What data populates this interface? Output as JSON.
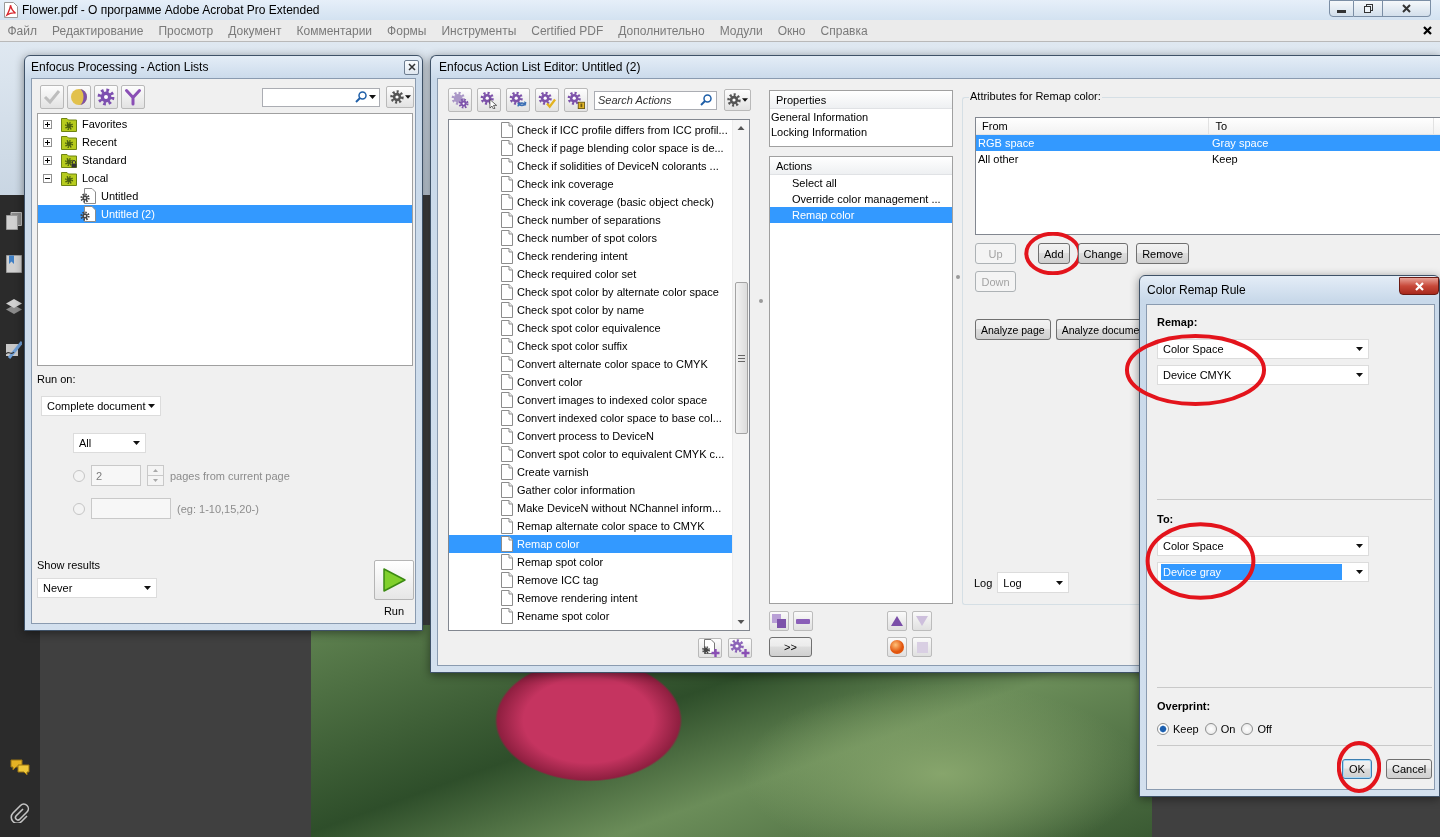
{
  "acrobat": {
    "title": "Flower.pdf - О программе Adobe Acrobat Pro Extended",
    "menu": [
      {
        "label": "Файл",
        "disabled": true
      },
      {
        "label": "Редактирование",
        "disabled": true
      },
      {
        "label": "Просмотр",
        "disabled": true
      },
      {
        "label": "Документ",
        "disabled": true
      },
      {
        "label": "Комментарии",
        "disabled": true
      },
      {
        "label": "Формы",
        "disabled": true
      },
      {
        "label": "Инструменты",
        "disabled": true
      },
      {
        "label": "Certified PDF",
        "disabled": true
      },
      {
        "label": "Дополнительно",
        "disabled": true
      },
      {
        "label": "Модули",
        "disabled": true
      },
      {
        "label": "Окно",
        "disabled": true
      },
      {
        "label": "Справка",
        "disabled": true
      }
    ]
  },
  "action_lists": {
    "title": "Enfocus Processing - Action Lists",
    "tree": [
      {
        "label": "Favorites",
        "expanded": false,
        "locked": false,
        "selected": false
      },
      {
        "label": "Recent",
        "expanded": false,
        "locked": false,
        "selected": false
      },
      {
        "label": "Standard",
        "expanded": false,
        "locked": true,
        "selected": false
      },
      {
        "label": "Local",
        "expanded": true,
        "locked": false,
        "selected": false,
        "children": [
          {
            "label": "Untitled",
            "selected": false
          },
          {
            "label": "Untitled (2)",
            "selected": true
          }
        ]
      }
    ],
    "run_on": {
      "label": "Run on:",
      "scope": "Complete document",
      "pages": "All",
      "options": [
        {
          "kind": "count",
          "value": "2",
          "label": "pages from current page",
          "selected": false,
          "disabled": true
        },
        {
          "kind": "range",
          "label": "(eg: 1-10,15,20-)",
          "selected": false,
          "disabled": true
        }
      ]
    },
    "show_results": {
      "label": "Show results",
      "value": "Never"
    },
    "run": {
      "label": "Run"
    }
  },
  "editor": {
    "title": "Enfocus Action List Editor: Untitled (2)",
    "search": {
      "placeholder": "Search Actions"
    },
    "library": [
      {
        "label": "Check if ICC profile differs from ICC profil...",
        "selected": false
      },
      {
        "label": "Check if page blending color space is de...",
        "selected": false
      },
      {
        "label": "Check if solidities of DeviceN colorants ...",
        "selected": false
      },
      {
        "label": "Check ink coverage",
        "selected": false
      },
      {
        "label": "Check ink coverage (basic object check)",
        "selected": false
      },
      {
        "label": "Check number of separations",
        "selected": false
      },
      {
        "label": "Check number of spot colors",
        "selected": false
      },
      {
        "label": "Check rendering intent",
        "selected": false
      },
      {
        "label": "Check required color set",
        "selected": false
      },
      {
        "label": "Check spot color by alternate color space",
        "selected": false
      },
      {
        "label": "Check spot color by name",
        "selected": false
      },
      {
        "label": "Check spot color equivalence",
        "selected": false
      },
      {
        "label": "Check spot color suffix",
        "selected": false
      },
      {
        "label": "Convert alternate color space to CMYK",
        "selected": false
      },
      {
        "label": "Convert color",
        "selected": false
      },
      {
        "label": "Convert images to indexed color space",
        "selected": false
      },
      {
        "label": "Convert indexed color space to base col...",
        "selected": false
      },
      {
        "label": "Convert process to DeviceN",
        "selected": false
      },
      {
        "label": "Convert spot color to equivalent CMYK c...",
        "selected": false
      },
      {
        "label": "Create varnish",
        "selected": false
      },
      {
        "label": "Gather color information",
        "selected": false
      },
      {
        "label": "Make DeviceN without NChannel inform...",
        "selected": false
      },
      {
        "label": "Remap alternate color space to CMYK",
        "selected": false
      },
      {
        "label": "Remap color",
        "selected": true
      },
      {
        "label": "Remap spot color",
        "selected": false
      },
      {
        "label": "Remove ICC tag",
        "selected": false
      },
      {
        "label": "Remove rendering intent",
        "selected": false
      },
      {
        "label": "Rename spot color",
        "selected": false
      }
    ],
    "properties": {
      "header": "Properties",
      "items": [
        "General Information",
        "Locking Information"
      ]
    },
    "actions": {
      "header": "Actions",
      "items": [
        {
          "label": "Select all",
          "selected": false
        },
        {
          "label": "Override color management ...",
          "selected": false
        },
        {
          "label": "Remap color",
          "selected": true
        }
      ]
    },
    "tools": [
      {
        "kind": "duplicate",
        "disabled": false
      },
      {
        "kind": "remove",
        "disabled": false
      },
      {
        "kind": "move_up",
        "disabled": false
      },
      {
        "kind": "move_down",
        "disabled": true
      },
      {
        "kind": "record",
        "disabled": false
      },
      {
        "kind": "stop",
        "disabled": true
      }
    ],
    "transfer": ">>",
    "attributes": {
      "title": "Attributes for Remap color:",
      "columns": [
        "From",
        "To"
      ],
      "rows": [
        {
          "cells": [
            "RGB space",
            "Gray space"
          ],
          "selected": true
        },
        {
          "cells": [
            "All other",
            "Keep"
          ],
          "selected": false
        }
      ],
      "buttons": [
        {
          "label": "Up",
          "disabled": true,
          "circled": false
        },
        {
          "label": "Add",
          "disabled": false,
          "circled": true
        },
        {
          "label": "Change",
          "disabled": false,
          "circled": false
        },
        {
          "label": "Remove",
          "disabled": false,
          "circled": false
        },
        {
          "label": "Down",
          "disabled": true,
          "circled": false
        }
      ],
      "analyze": [
        "Analyze page",
        "Analyze docume"
      ],
      "log": {
        "label": "Log",
        "value": "Log"
      }
    }
  },
  "dialog": {
    "title": "Color Remap Rule",
    "sections": [
      {
        "label": "Remap:",
        "circled": true,
        "fields": [
          {
            "value": "Color Space",
            "focused": false
          },
          {
            "value": "Device CMYK",
            "focused": false
          }
        ]
      },
      {
        "label": "To:",
        "circled": true,
        "fields": [
          {
            "value": "Color Space",
            "focused": false
          },
          {
            "value": "Device gray",
            "focused": true
          }
        ]
      }
    ],
    "overprint": {
      "label": "Overprint:",
      "options": [
        {
          "label": "Keep",
          "selected": true
        },
        {
          "label": "On",
          "selected": false
        },
        {
          "label": "Off",
          "selected": false
        }
      ]
    },
    "buttons": [
      {
        "label": "OK",
        "default": true,
        "circled": true
      },
      {
        "label": "Cancel",
        "default": false,
        "circled": false
      }
    ]
  }
}
